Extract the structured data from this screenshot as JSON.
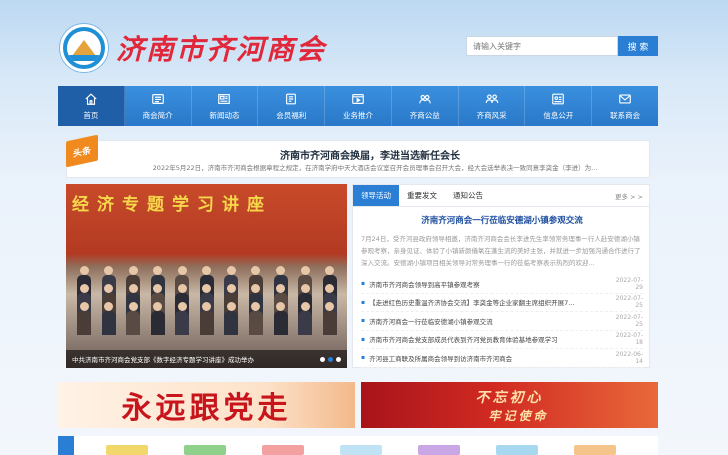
{
  "header": {
    "site_name": "济南市齐河商会",
    "search_placeholder": "请输入关键字",
    "search_button": "搜 索"
  },
  "nav": [
    {
      "label": "首页",
      "icon": "home-icon",
      "active": true
    },
    {
      "label": "商会简介",
      "icon": "intro-icon"
    },
    {
      "label": "新闻动态",
      "icon": "news-icon"
    },
    {
      "label": "会员福利",
      "icon": "benefit-icon"
    },
    {
      "label": "业务推介",
      "icon": "video-icon"
    },
    {
      "label": "齐商公益",
      "icon": "group-icon"
    },
    {
      "label": "齐商风采",
      "icon": "people-icon"
    },
    {
      "label": "信息公开",
      "icon": "info-icon"
    },
    {
      "label": "联系商会",
      "icon": "mail-icon"
    }
  ],
  "headline": {
    "tag": "头条",
    "title": "济南市齐河商会换届，李进当选新任会长",
    "summary": "2022年5月22日，济南市齐河商会根据章程之规定，在济南学府中天大酒店会议室召开会员理事会召开大会，经大会选举表决一致同意李䶮金（李进）为..."
  },
  "slider": {
    "banner_text": "经济专题学习讲座",
    "caption": "中共济南市齐河商会党支部《数字经济专题学习讲座》成功举办",
    "active_dot": 1
  },
  "news": {
    "tabs": [
      "领导活动",
      "重要发文",
      "通知公告"
    ],
    "more": "更多 > >",
    "feature_title": "济南齐河商会一行莅临安德湖小镇参观交流",
    "feature_summary": "7月24日，受齐河县政府领导相邀，济南齐河商会会长李进先生率领常务理事一行人赴安德湖小镇参观考察，亲身见证、体验了小镇新颜儀氧在蓬生流的美好主张，并就进一步加强沟通合作进行了深入交流。安德湖小镇项目相关领导对常务理事一行的莅临考察表示热烈的欢迎...",
    "items": [
      {
        "title": "济南市齐河商会领导到高平镇参观考察",
        "date": "2022-07-29"
      },
      {
        "title": "【走进红色历史重温齐济协会交流】李䶮金等企业家翻主席组织开展7...",
        "date": "2022-07-25"
      },
      {
        "title": "济南齐河商会一行莅临安德湖小镇参观交流",
        "date": "2022-07-25"
      },
      {
        "title": "济南市齐河商会党支部成员代表到齐河党员教育体验基地参观学习",
        "date": "2022-07-18"
      },
      {
        "title": "齐河县工商联及所属商会领导到访济南市齐河商会",
        "date": "2022-06-14"
      }
    ]
  },
  "ads": {
    "left": "永远跟党走",
    "right_line1": "不忘初心",
    "right_line2": "牢记使命"
  },
  "colors": {
    "brand_blue": "#2a7fd4",
    "brand_red": "#e0283a",
    "tag_orange": "#f08a1f"
  }
}
